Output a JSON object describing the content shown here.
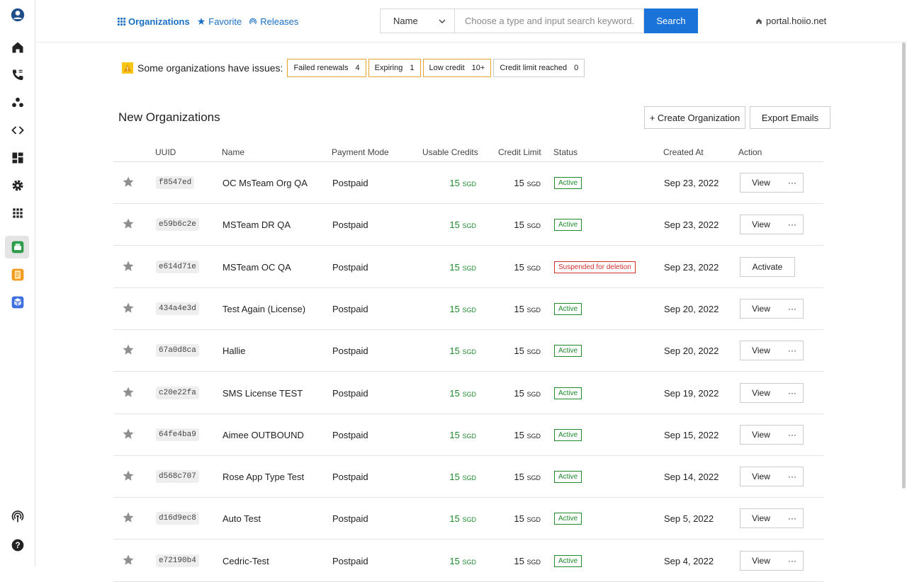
{
  "nav": {
    "organizations": "Organizations",
    "favorite": "Favorite",
    "releases": "Releases"
  },
  "search": {
    "field_select": "Name",
    "placeholder": "Choose a type and input search keyword...",
    "button": "Search"
  },
  "portal": "portal.hoiio.net",
  "issues": {
    "label": "Some organizations have issues:",
    "chips": [
      {
        "label": "Failed renewals",
        "count": "4"
      },
      {
        "label": "Expiring",
        "count": "1"
      },
      {
        "label": "Low credit",
        "count": "10+"
      },
      {
        "label": "Credit limit reached",
        "count": "0"
      }
    ]
  },
  "page_title": "New Organizations",
  "buttons": {
    "create": "+ Create Organization",
    "export": "Export Emails"
  },
  "columns": [
    "UUID",
    "Name",
    "Payment Mode",
    "Usable Credits",
    "Credit Limit",
    "Status",
    "Created At",
    "Action"
  ],
  "rows": [
    {
      "uuid": "f8547ed",
      "name": "OC MsTeam Org QA",
      "payment": "Postpaid",
      "credits": "15",
      "credits_unit": "SGD",
      "limit": "15",
      "limit_unit": "SGD",
      "status": "Active",
      "created": "Sep 23, 2022",
      "action": "View",
      "more": "···"
    },
    {
      "uuid": "e59b6c2e",
      "name": "MSTeam DR QA",
      "payment": "Postpaid",
      "credits": "15",
      "credits_unit": "SGD",
      "limit": "15",
      "limit_unit": "SGD",
      "status": "Active",
      "created": "Sep 23, 2022",
      "action": "View",
      "more": "···"
    },
    {
      "uuid": "e614d71e",
      "name": "MSTeam OC QA",
      "payment": "Postpaid",
      "credits": "15",
      "credits_unit": "SGD",
      "limit": "15",
      "limit_unit": "SGD",
      "status": "Suspended for deletion",
      "created": "Sep 23, 2022",
      "action": "Activate",
      "more": ""
    },
    {
      "uuid": "434a4e3d",
      "name": "Test Again (License)",
      "payment": "Postpaid",
      "credits": "15",
      "credits_unit": "SGD",
      "limit": "15",
      "limit_unit": "SGD",
      "status": "Active",
      "created": "Sep 20, 2022",
      "action": "View",
      "more": "···"
    },
    {
      "uuid": "67a0d8ca",
      "name": "Hallie",
      "payment": "Postpaid",
      "credits": "15",
      "credits_unit": "SGD",
      "limit": "15",
      "limit_unit": "SGD",
      "status": "Active",
      "created": "Sep 20, 2022",
      "action": "View",
      "more": "···"
    },
    {
      "uuid": "c20e22fa",
      "name": "SMS License TEST",
      "payment": "Postpaid",
      "credits": "15",
      "credits_unit": "SGD",
      "limit": "15",
      "limit_unit": "SGD",
      "status": "Active",
      "created": "Sep 19, 2022",
      "action": "View",
      "more": "···"
    },
    {
      "uuid": "64fe4ba9",
      "name": "Aimee OUTBOUND",
      "payment": "Postpaid",
      "credits": "15",
      "credits_unit": "SGD",
      "limit": "15",
      "limit_unit": "SGD",
      "status": "Active",
      "created": "Sep 15, 2022",
      "action": "View",
      "more": "···"
    },
    {
      "uuid": "d568c707",
      "name": "Rose App Type Test",
      "payment": "Postpaid",
      "credits": "15",
      "credits_unit": "SGD",
      "limit": "15",
      "limit_unit": "SGD",
      "status": "Active",
      "created": "Sep 14, 2022",
      "action": "View",
      "more": "···"
    },
    {
      "uuid": "d16d9ec8",
      "name": "Auto Test",
      "payment": "Postpaid",
      "credits": "15",
      "credits_unit": "SGD",
      "limit": "15",
      "limit_unit": "SGD",
      "status": "Active",
      "created": "Sep 5, 2022",
      "action": "View",
      "more": "···"
    },
    {
      "uuid": "e72190b4",
      "name": "Cedric-Test",
      "payment": "Postpaid",
      "credits": "15",
      "credits_unit": "SGD",
      "limit": "15",
      "limit_unit": "SGD",
      "status": "Active",
      "created": "Sep 4, 2022",
      "action": "View",
      "more": "···"
    }
  ],
  "colors": {
    "accent": "#1a73d9",
    "credit_green": "#1e8a2c",
    "status_green": "#1e8a2c",
    "status_red": "#d0312d",
    "chip_border": "#e5a532"
  },
  "rail_icons": [
    "user-avatar-icon",
    "home-icon",
    "phone-icon",
    "team-icon",
    "code-icon",
    "dashboard-icon",
    "settings-icon",
    "apps-grid-icon",
    "store-app-icon",
    "notes-app-icon",
    "package-app-icon",
    "broadcast-icon",
    "help-icon"
  ]
}
